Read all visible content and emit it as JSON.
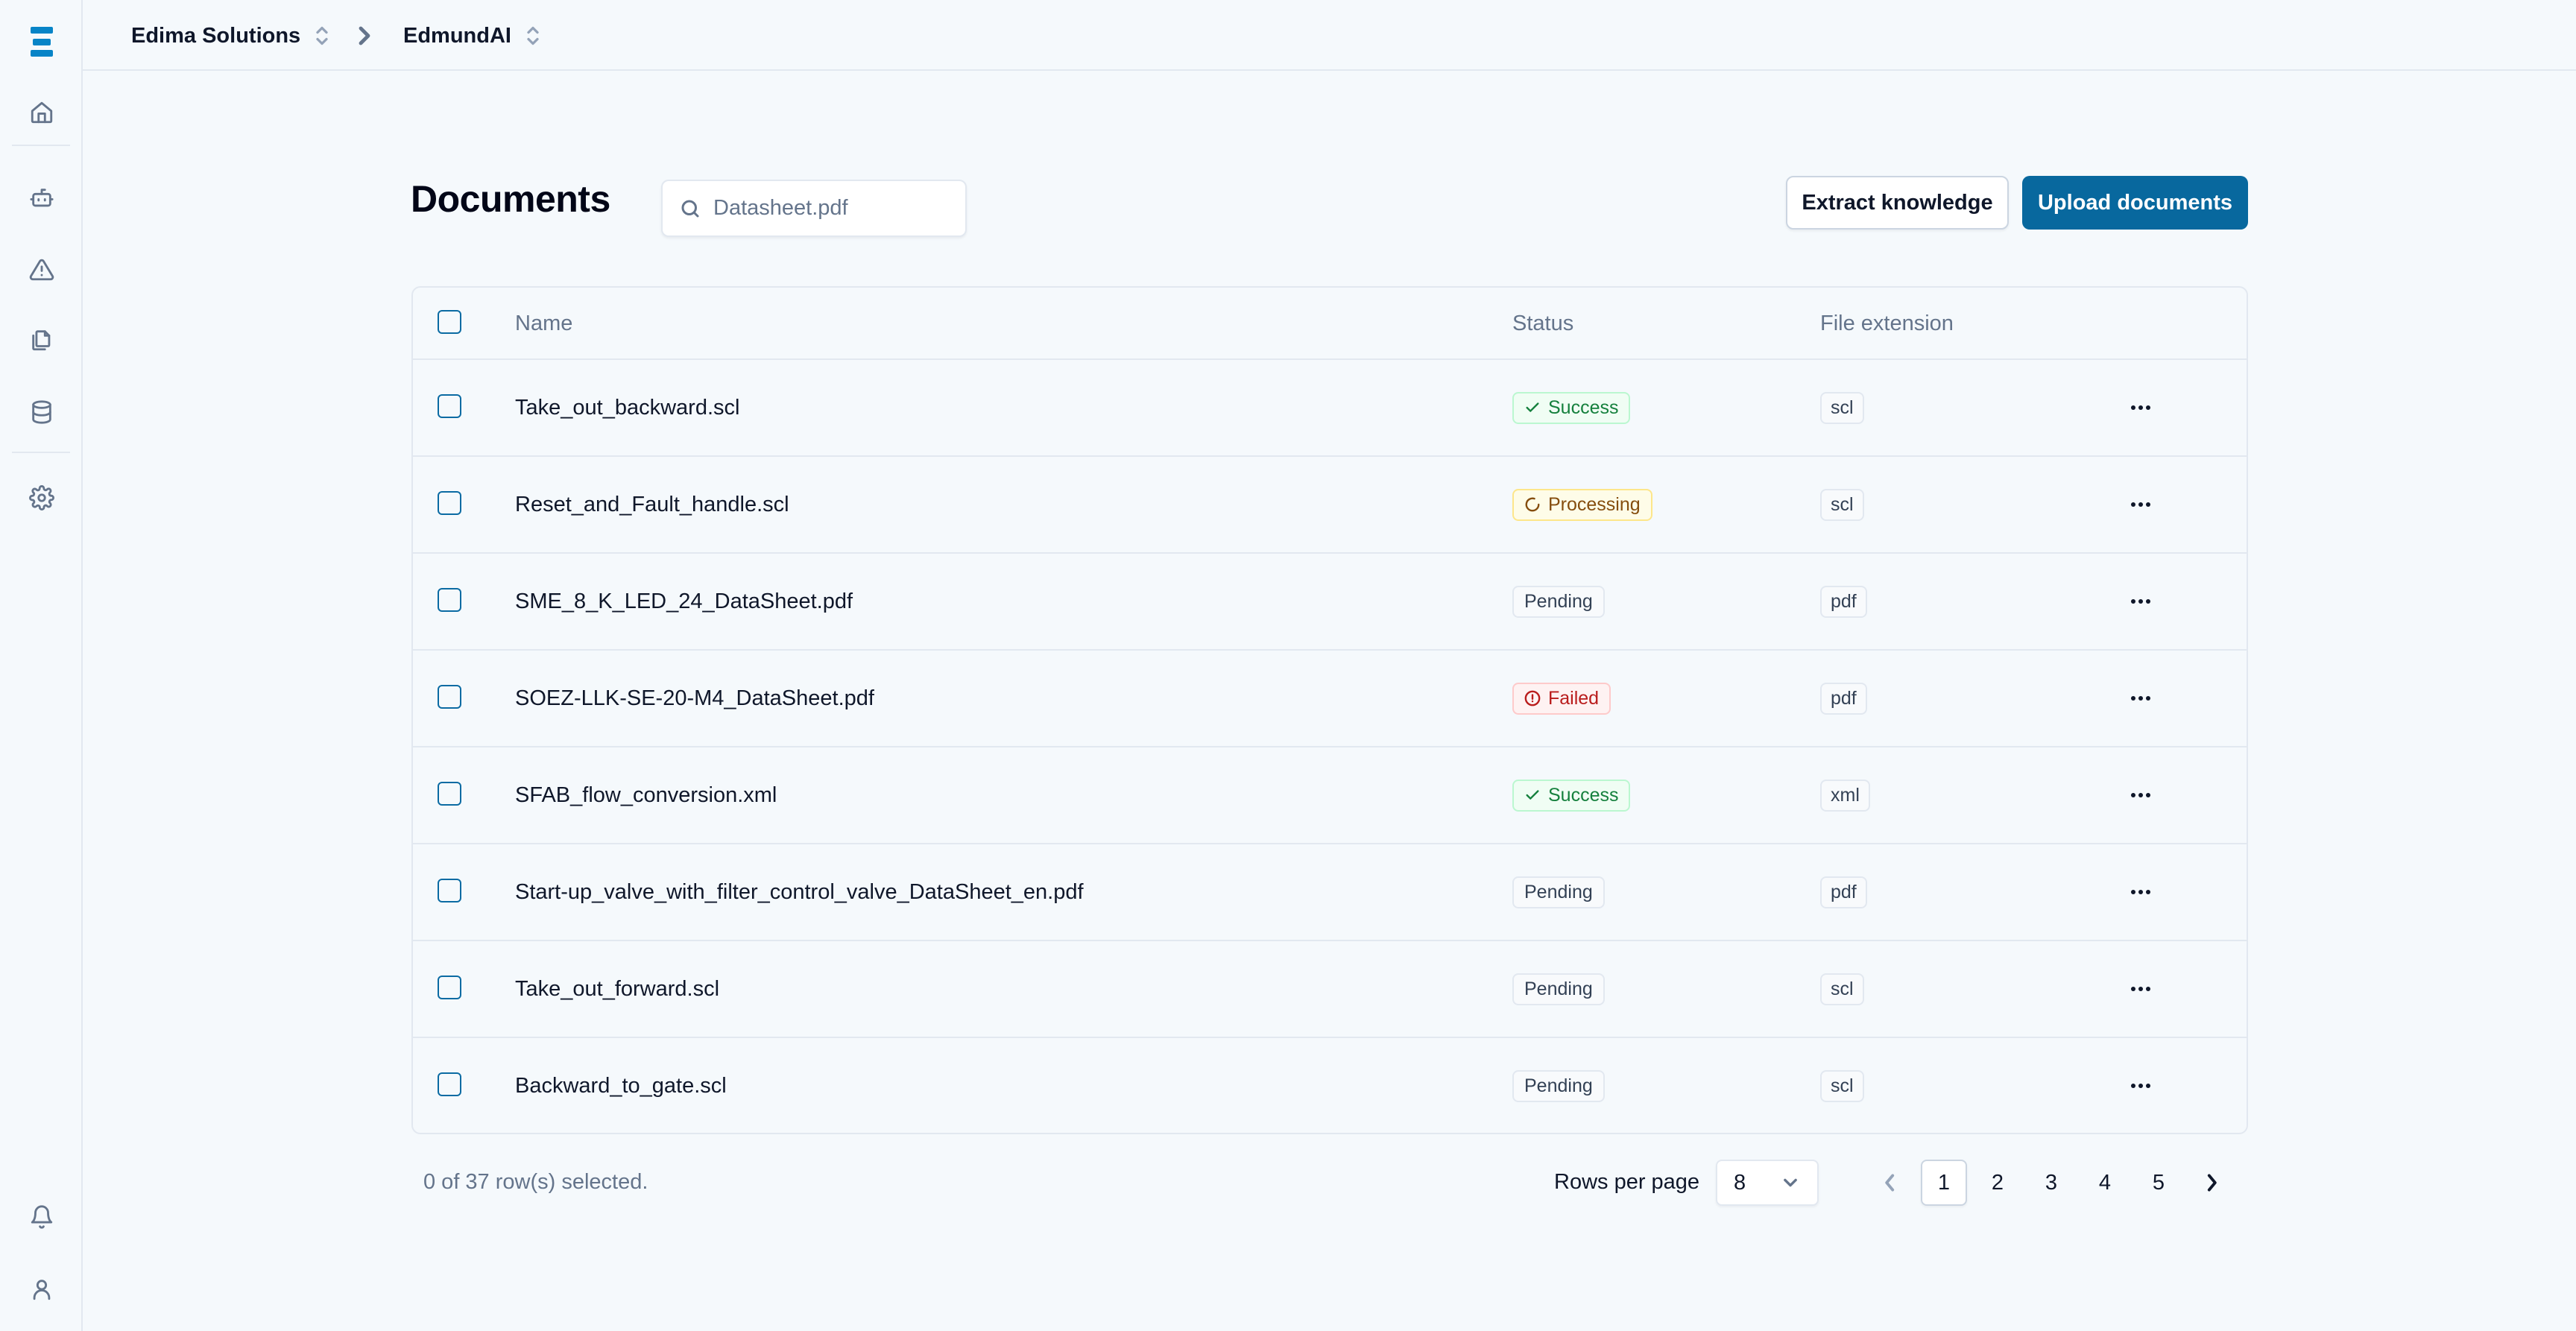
{
  "sidebar": {
    "logo": "edima-logo",
    "items": [
      {
        "id": "home",
        "icon": "home-icon"
      },
      {
        "id": "assistant",
        "icon": "bot-icon"
      },
      {
        "id": "alerts",
        "icon": "warning-icon"
      },
      {
        "id": "documents",
        "icon": "files-icon"
      },
      {
        "id": "data",
        "icon": "database-icon"
      },
      {
        "id": "settings",
        "icon": "gear-icon"
      }
    ],
    "bottom_items": [
      {
        "id": "notifications",
        "icon": "bell-icon"
      },
      {
        "id": "profile",
        "icon": "user-icon"
      }
    ]
  },
  "header": {
    "breadcrumb": [
      {
        "label": "Edima Solutions"
      },
      {
        "label": "EdmundAI"
      }
    ]
  },
  "page": {
    "title": "Documents",
    "search": {
      "value": "",
      "placeholder": "Datasheet.pdf"
    },
    "actions": {
      "extract_label": "Extract knowledge",
      "upload_label": "Upload documents"
    }
  },
  "table": {
    "columns": {
      "name": "Name",
      "status": "Status",
      "extension": "File extension"
    },
    "rows": [
      {
        "name": "Take_out_backward.scl",
        "status": "Success",
        "status_type": "success",
        "extension": "scl"
      },
      {
        "name": "Reset_and_Fault_handle.scl",
        "status": "Processing",
        "status_type": "processing",
        "extension": "scl"
      },
      {
        "name": "SME_8_K_LED_24_DataSheet.pdf",
        "status": "Pending",
        "status_type": "pending",
        "extension": "pdf"
      },
      {
        "name": "SOEZ-LLK-SE-20-M4_DataSheet.pdf",
        "status": "Failed",
        "status_type": "failed",
        "extension": "pdf"
      },
      {
        "name": "SFAB_flow_conversion.xml",
        "status": "Success",
        "status_type": "success",
        "extension": "xml"
      },
      {
        "name": "Start-up_valve_with_filter_control_valve_DataSheet_en.pdf",
        "status": "Pending",
        "status_type": "pending",
        "extension": "pdf"
      },
      {
        "name": "Take_out_forward.scl",
        "status": "Pending",
        "status_type": "pending",
        "extension": "scl"
      },
      {
        "name": "Backward_to_gate.scl",
        "status": "Pending",
        "status_type": "pending",
        "extension": "scl"
      }
    ]
  },
  "footer": {
    "selection_text": "0 of 37 row(s) selected.",
    "rows_per_page_label": "Rows per page",
    "rows_per_page_value": "8",
    "pages": [
      "1",
      "2",
      "3",
      "4",
      "5"
    ],
    "current_page": "1"
  },
  "colors": {
    "brand": "#0784C7",
    "primary_button": "#08689E",
    "success": "#15803D",
    "processing": "#854D0E",
    "failed": "#B91C1C",
    "pending": "#334155"
  }
}
